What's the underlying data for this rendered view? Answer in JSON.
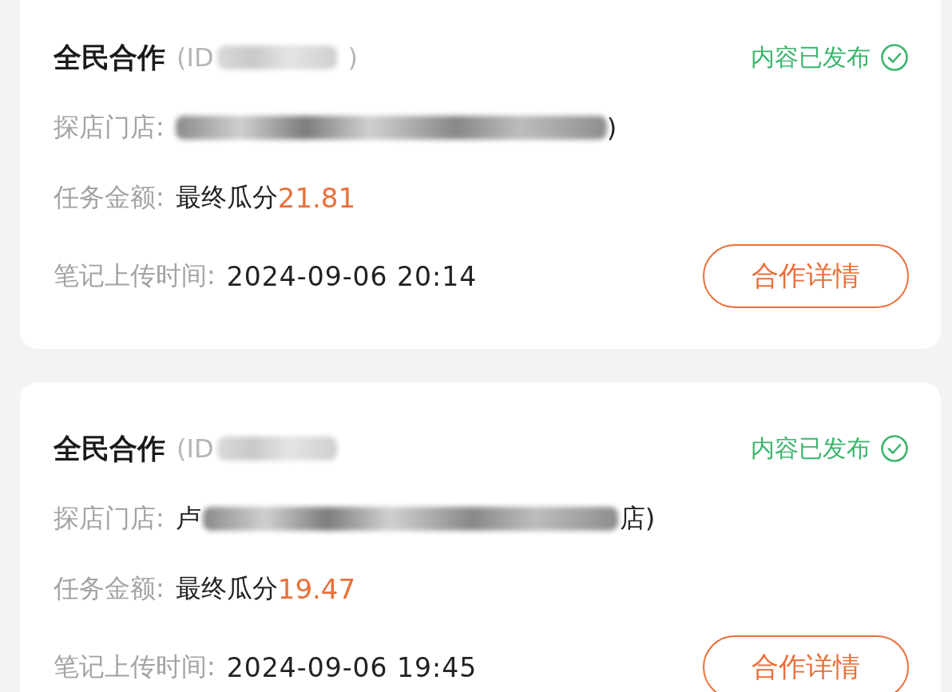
{
  "cards": [
    {
      "title": "全民合作",
      "id_start": "(ID",
      "id_end": ")",
      "status": "内容已发布",
      "store_label": "探店门店:",
      "store_end": ")",
      "amount_label": "任务金额:",
      "amount_text": "最终瓜分",
      "amount": "21.81",
      "time_label": "笔记上传时间:",
      "time": "2024-09-06 20:14",
      "button": "合作详情"
    },
    {
      "title": "全民合作",
      "id_start": "(ID",
      "status": "内容已发布",
      "store_label": "探店门店:",
      "store_start": "卢",
      "store_end": "店)",
      "amount_label": "任务金额:",
      "amount_text": "最终瓜分",
      "amount": "19.47",
      "time_label": "笔记上传时间:",
      "time": "2024-09-06 19:45",
      "button": "合作详情"
    }
  ]
}
